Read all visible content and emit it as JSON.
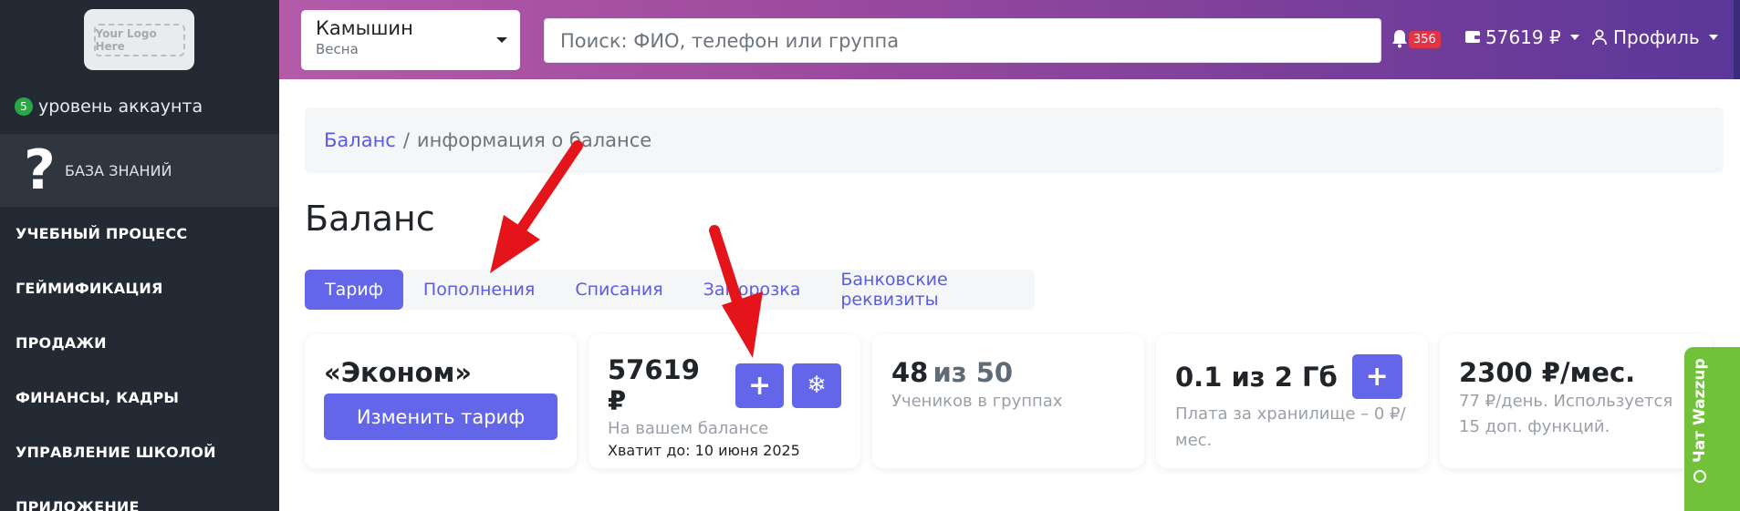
{
  "sidebar": {
    "logo_text": "Your Logo Here",
    "account_level": {
      "badge": "5",
      "label": "уровень аккаунта"
    },
    "knowledge_base": {
      "icon": "question-icon",
      "label": "БАЗА ЗНАНИЙ"
    },
    "items": [
      {
        "label": "УЧЕБНЫЙ ПРОЦЕСС"
      },
      {
        "label": "ГЕЙМИФИКАЦИЯ"
      },
      {
        "label": "ПРОДАЖИ"
      },
      {
        "label": "ФИНАНСЫ, КАДРЫ"
      },
      {
        "label": "УПРАВЛЕНИЕ ШКОЛОЙ"
      },
      {
        "label": "ПРИЛОЖЕНИЕ"
      }
    ]
  },
  "header": {
    "school": {
      "name": "Камышин",
      "season": "Весна"
    },
    "search": {
      "placeholder": "Поиск: ФИО, телефон или группа",
      "value": ""
    },
    "notifications": {
      "icon": "bell-icon",
      "count": "356"
    },
    "balance": {
      "icon": "wallet-icon",
      "value": "57619 ₽"
    },
    "profile": {
      "icon": "user-icon",
      "label": "Профиль"
    }
  },
  "breadcrumb": {
    "link": "Баланс",
    "separator": "/",
    "current": "информация о балансе"
  },
  "page_title": "Баланс",
  "tabs": [
    {
      "label": "Тариф",
      "active": true
    },
    {
      "label": "Пополнения",
      "active": false
    },
    {
      "label": "Списания",
      "active": false
    },
    {
      "label": "Заморозка",
      "active": false
    },
    {
      "label": "Банковские реквизиты",
      "active": false
    }
  ],
  "cards": {
    "tariff": {
      "title": "«Эконом»",
      "button": "Изменить тариф"
    },
    "balance": {
      "value": "57619 ₽",
      "add_icon": "+",
      "freeze_icon": "❄",
      "caption": "На вашем балансе",
      "until": "Хватит до: 10 июня 2025"
    },
    "students": {
      "value": "48",
      "of": "из 50",
      "caption": "Учеников в группах"
    },
    "storage": {
      "value": "0.1 из 2 Гб",
      "add_icon": "+",
      "caption_line1": "Плата за хранилище – 0 ₽/",
      "caption_line2": "мес."
    },
    "price": {
      "value": "2300 ₽/мес.",
      "caption_line1": "77 ₽/день. Используется",
      "caption_line2": "15 доп. функций."
    }
  },
  "chat": {
    "label": "Чат Wazzup"
  },
  "colors": {
    "accent": "#6366e8",
    "sidebar": "#232a34",
    "badge_red": "#e03546",
    "chat_green": "#71c23a",
    "annotation_red": "#e5141a"
  }
}
